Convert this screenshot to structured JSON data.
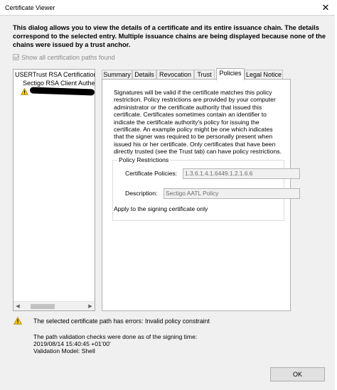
{
  "window": {
    "title": "Certificate Viewer",
    "close_glyph": "✕"
  },
  "intro_text": "This dialog allows you to view the details of a certificate and its entire issuance chain. The details correspond to the selected entry. Multiple issuance chains are being displayed because none of the chains were issued by a trust anchor.",
  "show_all_paths": {
    "label": "Show all certification paths found",
    "checked": true,
    "enabled": false
  },
  "tree": {
    "items": [
      {
        "label": "USERTrust RSA Certification A",
        "level": 0
      },
      {
        "label": "Sectigo RSA Client Authen",
        "level": 1
      },
      {
        "label": "",
        "level": 2,
        "icon": "warning-icon",
        "redacted": true
      }
    ]
  },
  "tabs": [
    {
      "label": "Summary",
      "active": false
    },
    {
      "label": "Details",
      "active": false
    },
    {
      "label": "Revocation",
      "active": false
    },
    {
      "label": "Trust",
      "active": false
    },
    {
      "label": "Policies",
      "active": true
    },
    {
      "label": "Legal Notice",
      "active": false
    }
  ],
  "policies": {
    "description": "Signatures will be valid if the certificate matches this policy restriction. Policy restrictions are provided by your computer administrator or the certificate authority that issued this certificate. Certificates sometimes contain an identifier to indicate the certificate authority's policy for issuing the certificate. An example policy might be one which indicates that the signer was required to be personally present when issued his or her certificate. Only certificates that have been directly trusted (see the Trust tab) can have policy restrictions.",
    "group_title": "Policy Restrictions",
    "cert_policies_label": "Certificate Policies:",
    "cert_policies_value": "1.3.6.1.4.1.6449.1.2.1.6.6",
    "description_label": "Description:",
    "description_value": "Sectigo AATL Policy",
    "apply_text": "Apply to the signing certificate only"
  },
  "status": {
    "error_text": "The selected certificate path has errors: Invalid policy constraint",
    "validation_line1": "The path validation checks were done as of the signing time:",
    "validation_line2": "2019/08/14 15:40:45 +01'00'",
    "validation_line3": "Validation Model: Shell"
  },
  "buttons": {
    "ok_label": "OK"
  },
  "colors": {
    "warning_fill": "#f5c400",
    "dialog_bg": "#f0f0f0",
    "panel_bg": "#ffffff"
  }
}
